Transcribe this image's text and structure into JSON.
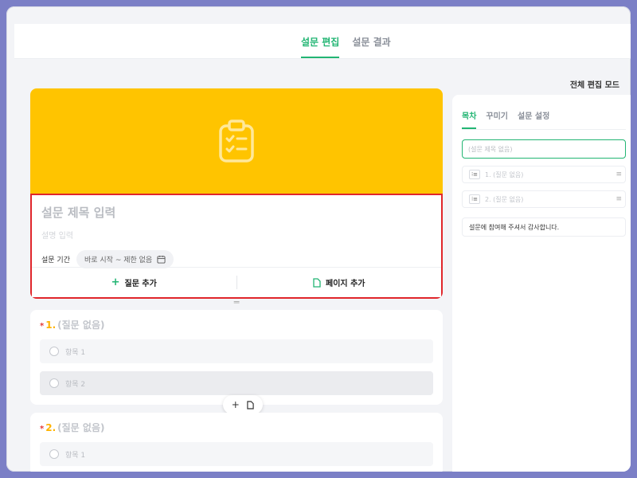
{
  "header": {
    "tabs": [
      {
        "label": "설문 편집",
        "active": true
      },
      {
        "label": "설문 결과",
        "active": false
      }
    ],
    "edit_mode_label": "전체 편집 모드"
  },
  "survey": {
    "banner_icon": "clipboard-check-icon",
    "title_placeholder": "설문 제목 입력",
    "description_placeholder": "설명 입력",
    "period_label": "설문 기간",
    "period_value": "바로 시작 ~ 제한 없음",
    "add_question_label": "질문 추가",
    "add_page_label": "페이지 추가"
  },
  "questions": [
    {
      "number": "1.",
      "title": "(질문 없음)",
      "options": [
        "항목 1",
        "항목 2"
      ]
    },
    {
      "number": "2.",
      "title": "(질문 없음)",
      "options": [
        "항목 1"
      ]
    }
  ],
  "right_panel": {
    "tabs": [
      {
        "label": "목차",
        "active": true
      },
      {
        "label": "꾸미기",
        "active": false
      },
      {
        "label": "설문 설정",
        "active": false
      }
    ],
    "title_placeholder": "(설문 제목 없음)",
    "items": [
      "1. (질문 없음)",
      "2. (질문 없음)"
    ],
    "end_message": "설문에 참여해 주셔서 감사합니다."
  },
  "colors": {
    "accent": "#22b573",
    "banner": "#ffc400",
    "highlight_border": "#e0262b",
    "required": "#e53935",
    "number": "#ffb300"
  }
}
